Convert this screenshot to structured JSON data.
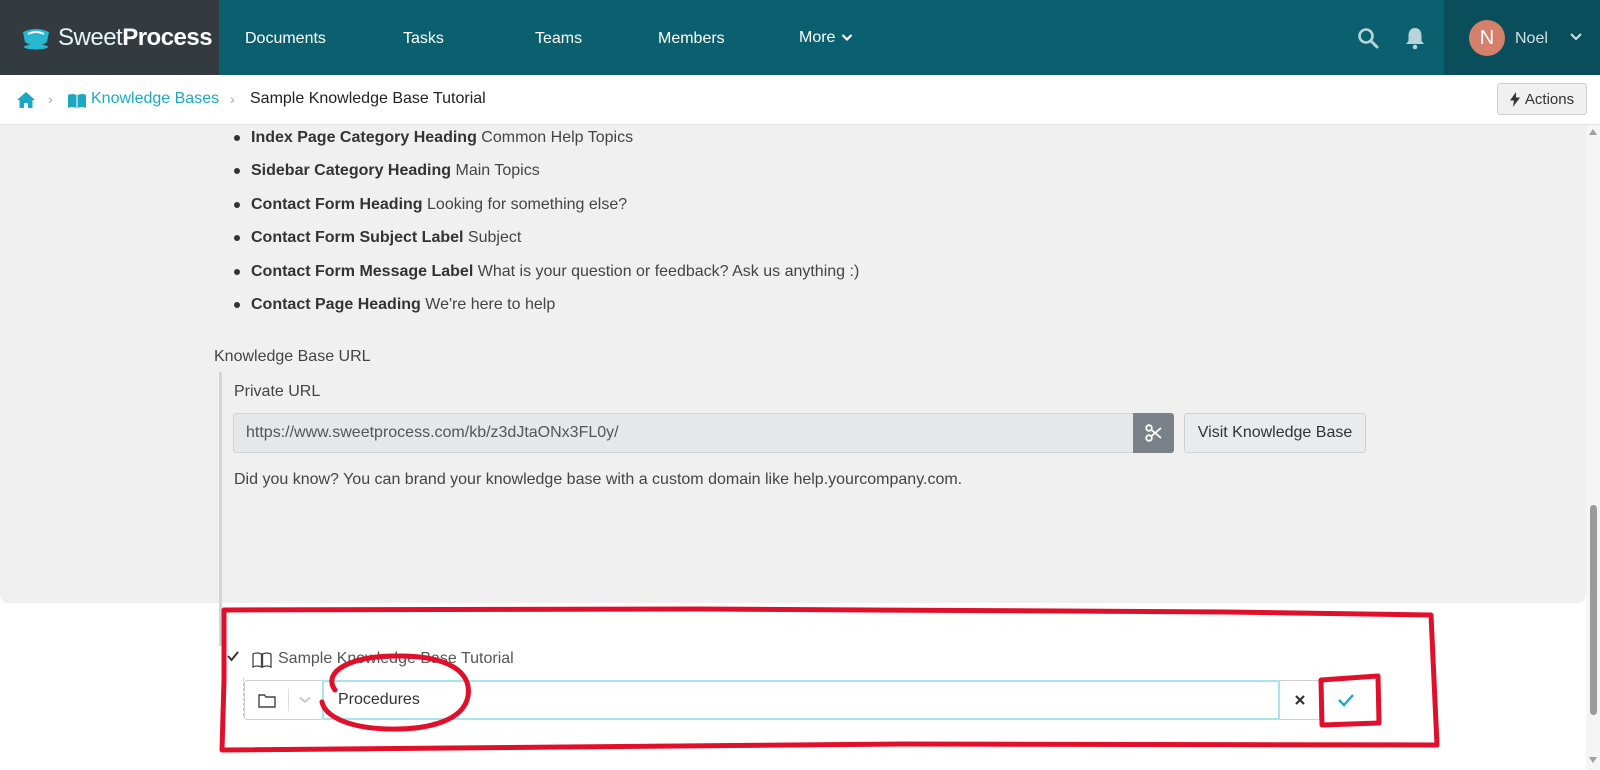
{
  "brand": {
    "name_part1": "Sweet",
    "name_part2": "Process"
  },
  "nav": {
    "items": [
      "Documents",
      "Tasks",
      "Teams",
      "Members"
    ],
    "more_label": "More"
  },
  "user": {
    "initial": "N",
    "name": "Noel"
  },
  "breadcrumb": {
    "parent": "Knowledge Bases",
    "current": "Sample Knowledge Base Tutorial",
    "actions_label": "Actions"
  },
  "settings": [
    {
      "key": "Index Page Category Heading",
      "value": "Common Help Topics"
    },
    {
      "key": "Sidebar Category Heading",
      "value": "Main Topics"
    },
    {
      "key": "Contact Form Heading",
      "value": "Looking for something else?"
    },
    {
      "key": "Contact Form Subject Label",
      "value": "Subject"
    },
    {
      "key": "Contact Form Message Label",
      "value": "What is your question or feedback? Ask us anything :)"
    },
    {
      "key": "Contact Page Heading",
      "value": "We're here to help"
    }
  ],
  "kb_url": {
    "heading": "Knowledge Base URL",
    "private_label": "Private URL",
    "url": "https://www.sweetprocess.com/kb/z3dJtaONx3FL0y/",
    "visit_label": "Visit Knowledge Base",
    "tip": "Did you know? You can brand your knowledge base with a custom domain like help.yourcompany.com."
  },
  "tree": {
    "kb_label": "Sample Knowledge Base Tutorial",
    "new_item_value": "Procedures"
  },
  "colors": {
    "nav_bg": "#0b6070",
    "accent": "#1ba8c3",
    "annotation_red": "#e0102b"
  }
}
